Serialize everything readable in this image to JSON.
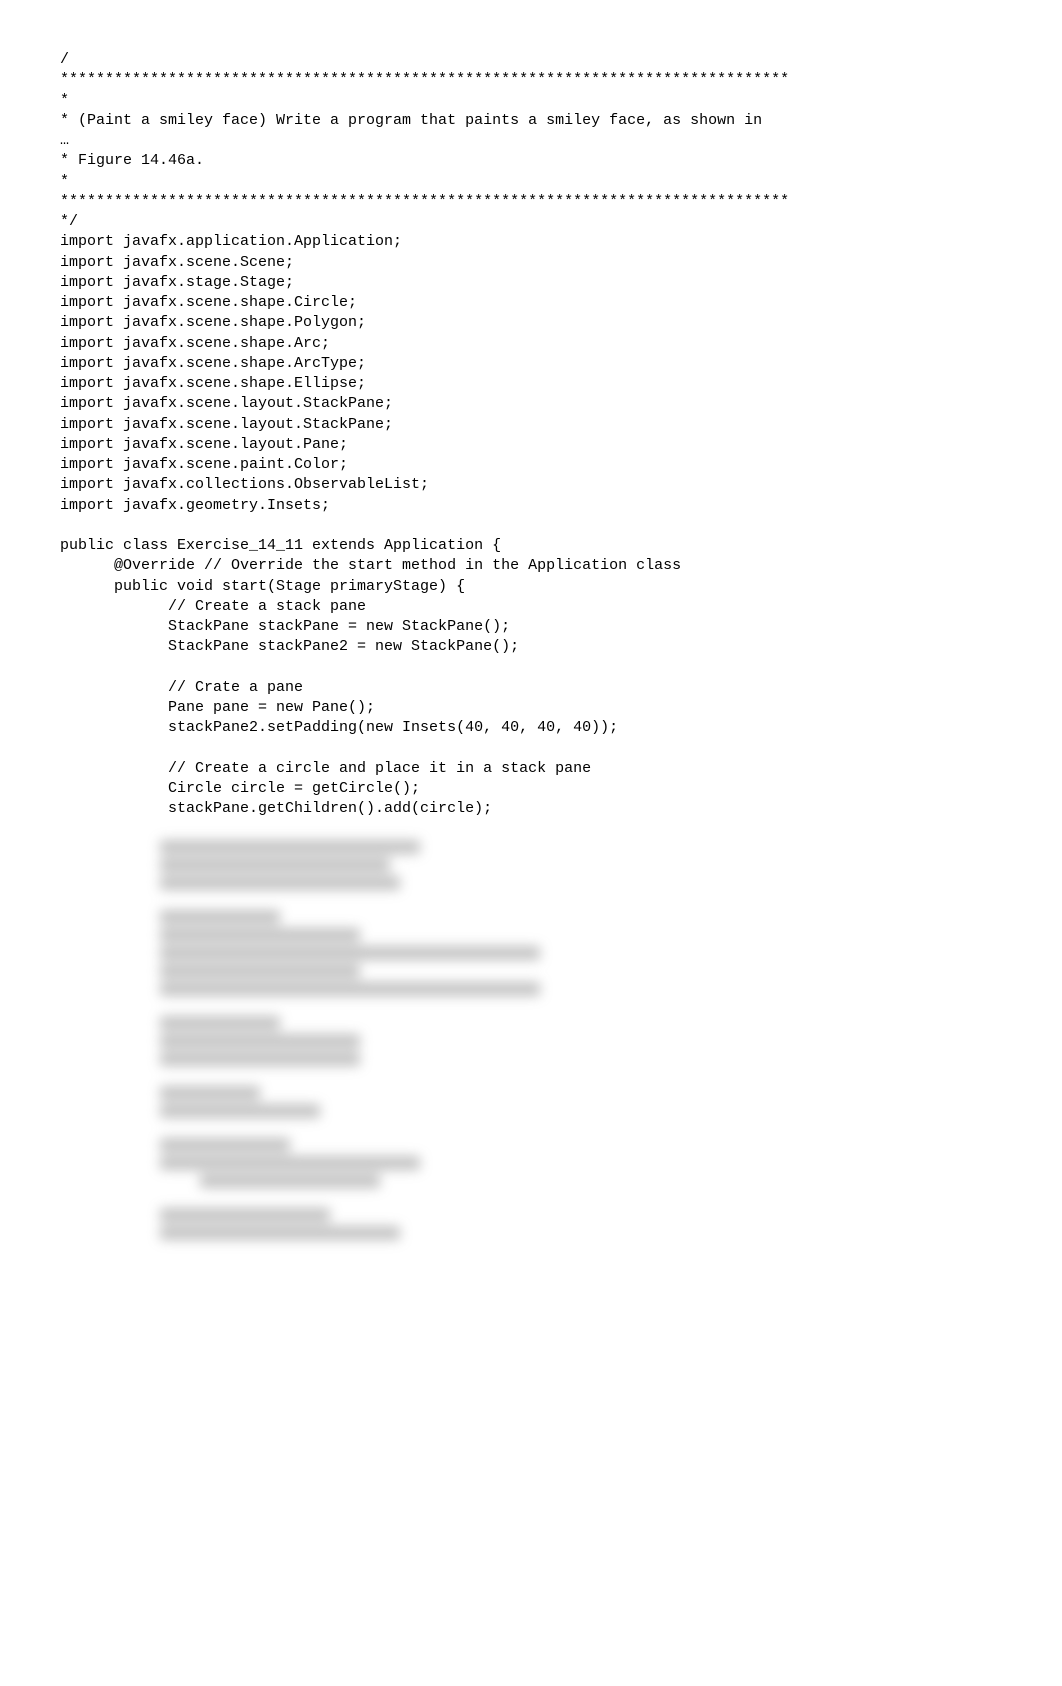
{
  "code": {
    "l01": "/",
    "l02": "*********************************************************************************",
    "l03": "*",
    "l04": "* (Paint a smiley face) Write a program that paints a smiley face, as shown in",
    "l05": "…",
    "l06": "* Figure 14.46a.",
    "l07": "*",
    "l08": "*********************************************************************************",
    "l09": "*/",
    "l10": "import javafx.application.Application;",
    "l11": "import javafx.scene.Scene;",
    "l12": "import javafx.stage.Stage;",
    "l13": "import javafx.scene.shape.Circle;",
    "l14": "import javafx.scene.shape.Polygon;",
    "l15": "import javafx.scene.shape.Arc;",
    "l16": "import javafx.scene.shape.ArcType;",
    "l17": "import javafx.scene.shape.Ellipse;",
    "l18": "import javafx.scene.layout.StackPane;",
    "l19": "import javafx.scene.layout.StackPane;",
    "l20": "import javafx.scene.layout.Pane;",
    "l21": "import javafx.scene.paint.Color;",
    "l22": "import javafx.collections.ObservableList;",
    "l23": "import javafx.geometry.Insets;",
    "l24": "",
    "l25": "public class Exercise_14_11 extends Application {",
    "l26": "      @Override // Override the start method in the Application class",
    "l27": "      public void start(Stage primaryStage) {",
    "l28": "            // Create a stack pane",
    "l29": "            StackPane stackPane = new StackPane();",
    "l30": "            StackPane stackPane2 = new StackPane();",
    "l31": "",
    "l32": "            // Crate a pane",
    "l33": "            Pane pane = new Pane();",
    "l34": "            stackPane2.setPadding(new Insets(40, 40, 40, 40));",
    "l35": "",
    "l36": "            // Create a circle and place it in a stack pane",
    "l37": "            Circle circle = getCircle();",
    "l38": "            stackPane.getChildren().add(circle);"
  }
}
